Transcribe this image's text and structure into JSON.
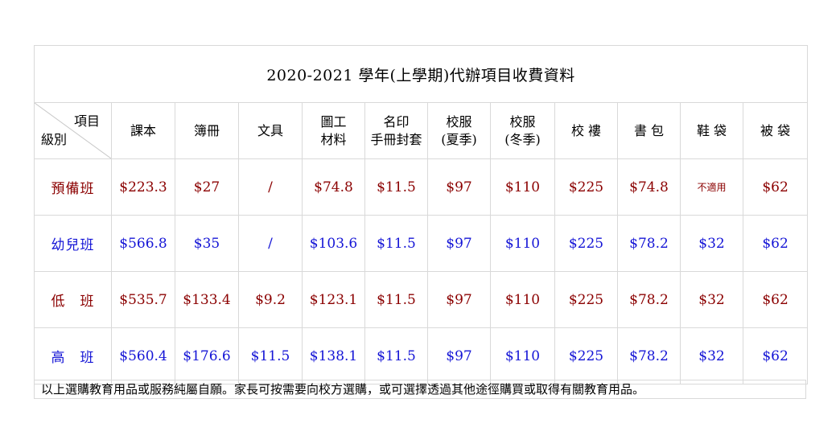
{
  "title": "2020-2021 學年(上學期)代辦項目收費資料",
  "corner": {
    "top_right": "項目",
    "bottom_left": "級別"
  },
  "columns": [
    {
      "line1": "課本",
      "line2": ""
    },
    {
      "line1": "簿冊",
      "line2": ""
    },
    {
      "line1": "文具",
      "line2": ""
    },
    {
      "line1": "圖工",
      "line2": "材料"
    },
    {
      "line1": "名印",
      "line2": "手冊封套"
    },
    {
      "line1": "校服",
      "line2": "(夏季)"
    },
    {
      "line1": "校服",
      "line2": "(冬季)"
    },
    {
      "line1": "校 褸",
      "line2": ""
    },
    {
      "line1": "書 包",
      "line2": ""
    },
    {
      "line1": "鞋 袋",
      "line2": ""
    },
    {
      "line1": "被 袋",
      "line2": ""
    }
  ],
  "rows": [
    {
      "label": "預備班",
      "color": "#8b0000",
      "cells": [
        "$223.3",
        "$27",
        "/",
        "$74.8",
        "$11.5",
        "$97",
        "$110",
        "$225",
        "$74.8",
        "不適用",
        "$62"
      ]
    },
    {
      "label": "幼兒班",
      "color": "#1515d6",
      "cells": [
        "$566.8",
        "$35",
        "/",
        "$103.6",
        "$11.5",
        "$97",
        "$110",
        "$225",
        "$78.2",
        "$32",
        "$62"
      ]
    },
    {
      "label": "低　班",
      "color": "#8b0000",
      "cells": [
        "$535.7",
        "$133.4",
        "$9.2",
        "$123.1",
        "$11.5",
        "$97",
        "$110",
        "$225",
        "$78.2",
        "$32",
        "$62"
      ]
    },
    {
      "label": "高　班",
      "color": "#1515d6",
      "cells": [
        "$560.4",
        "$176.6",
        "$11.5",
        "$138.1",
        "$11.5",
        "$97",
        "$110",
        "$225",
        "$78.2",
        "$32",
        "$62"
      ]
    }
  ],
  "footnote": "以上選購教育用品或服務純屬自願。家長可按需要向校方選購，或可選擇透過其他途徑購買或取得有關教育用品。"
}
